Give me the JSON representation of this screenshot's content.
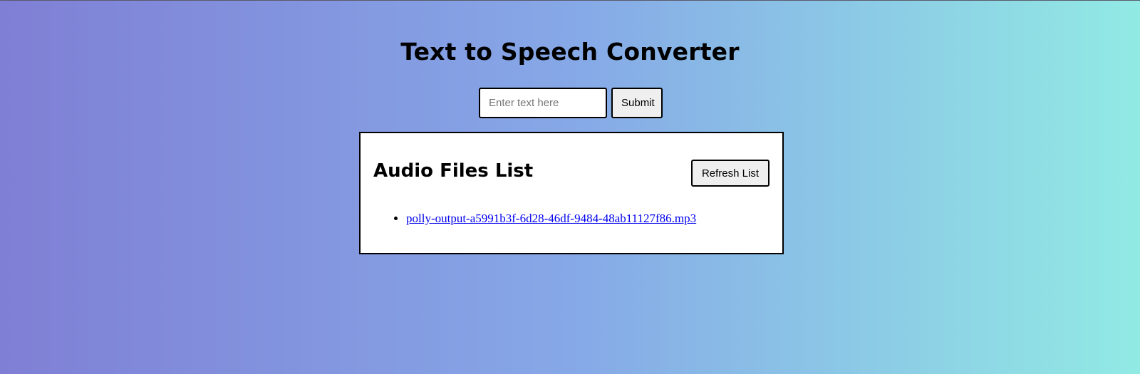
{
  "header": {
    "title": "Text to Speech Converter"
  },
  "form": {
    "input_value": "",
    "input_placeholder": "Enter text here",
    "submit_label": "Submit"
  },
  "audio_panel": {
    "title": "Audio Files List",
    "refresh_label": "Refresh List",
    "files": [
      {
        "name": "polly-output-a5991b3f-6d28-46df-9484-48ab11127f86.mp3"
      }
    ]
  },
  "colors": {
    "gradient_start": "#7f7fd5",
    "gradient_mid": "#86a8e7",
    "gradient_end": "#91eae4",
    "link": "#0000ee"
  }
}
